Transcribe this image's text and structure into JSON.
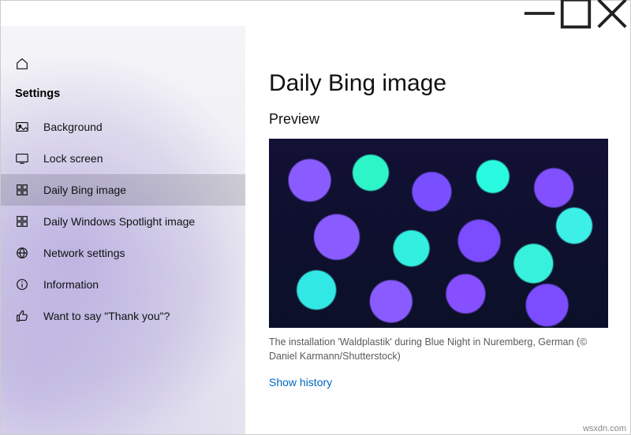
{
  "sidebar": {
    "section_title": "Settings",
    "items": [
      {
        "label": "Background",
        "icon": "picture-icon",
        "selected": false
      },
      {
        "label": "Lock screen",
        "icon": "lock-screen-icon",
        "selected": false
      },
      {
        "label": "Daily Bing image",
        "icon": "bing-icon",
        "selected": true
      },
      {
        "label": "Daily Windows Spotlight image",
        "icon": "spotlight-icon",
        "selected": false
      },
      {
        "label": "Network settings",
        "icon": "globe-icon",
        "selected": false
      },
      {
        "label": "Information",
        "icon": "info-icon",
        "selected": false
      },
      {
        "label": "Want to say \"Thank you\"?",
        "icon": "thumbs-up-icon",
        "selected": false
      }
    ]
  },
  "content": {
    "title": "Daily Bing image",
    "section": "Preview",
    "caption": "The installation 'Waldplastik' during Blue Night in Nuremberg, German (© Daniel Karmann/Shutterstock)",
    "history_link": "Show history"
  },
  "watermark": "wsxdn.com"
}
